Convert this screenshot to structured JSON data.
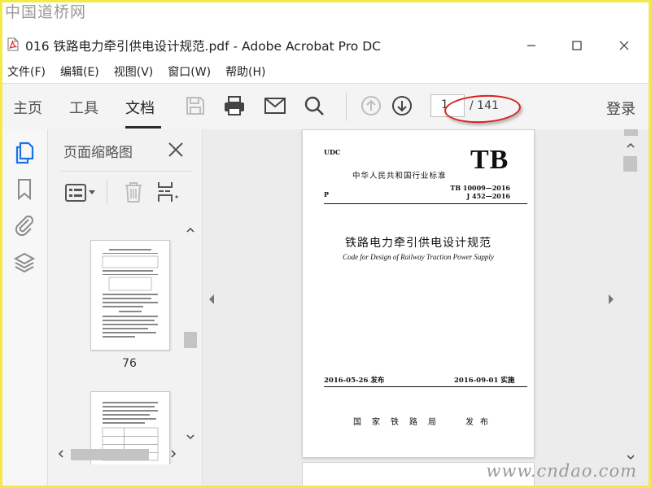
{
  "watermark": {
    "top": "中国道桥网",
    "bottom": "www.cndao.com"
  },
  "window": {
    "title": "016 铁路电力牵引供电设计规范.pdf - Adobe Acrobat Pro DC",
    "icons": [
      "pdf-file-icon",
      "minimize-icon",
      "maximize-icon",
      "close-icon"
    ]
  },
  "menu": {
    "items": [
      "文件(F)",
      "编辑(E)",
      "视图(V)",
      "窗口(W)",
      "帮助(H)"
    ]
  },
  "toolbar": {
    "tabs": [
      "主页",
      "工具",
      "文档"
    ],
    "active_tab": "文档",
    "tools": [
      "save-icon",
      "print-icon",
      "email-icon",
      "search-icon",
      "prev-page-icon",
      "next-page-icon"
    ],
    "page_current": "1",
    "page_total": "/ 141",
    "login": "登录",
    "highlight_color": "#d8221c"
  },
  "left_rail": {
    "icons": [
      "page-thumbnails-icon",
      "bookmarks-icon",
      "attachments-icon",
      "layers-icon"
    ],
    "accent": "#1a73e8"
  },
  "thumbnail_panel": {
    "title": "页面缩略图",
    "icons": [
      "options-menu-icon",
      "delete-icon",
      "insert-page-icon",
      "close-icon"
    ],
    "thumbnails": [
      {
        "page_number": "76"
      },
      {
        "page_number": ""
      }
    ]
  },
  "document": {
    "udc": "UDC",
    "tb_logo": "TB",
    "standard_type": "中华人民共和国行业标准",
    "code_1": "TB 10009—2016",
    "code_2": "J 452—2016",
    "p_label": "P",
    "title_cn": "铁路电力牵引供电设计规范",
    "title_en": "Code for Design of Railway Traction Power Supply",
    "issue_date": "2016-05-26  发布",
    "effective_date": "2016-09-01  实施",
    "issuer": "国家铁路局",
    "publish": "发布"
  }
}
